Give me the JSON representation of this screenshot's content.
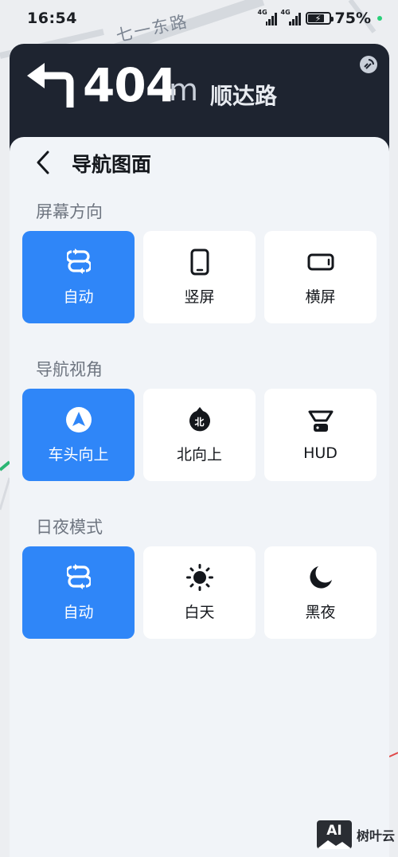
{
  "status_bar": {
    "time": "16:54",
    "signal_1_label": "4G",
    "signal_2_label": "4G",
    "battery_percent": "75%",
    "battery_level": 0.75
  },
  "map": {
    "road_name": "七一东路"
  },
  "navigation": {
    "distance_value": "404",
    "distance_unit": "m",
    "street_name": "顺达路",
    "turn_direction": "turn-left-icon"
  },
  "settings": {
    "title": "导航图面",
    "sections": [
      {
        "label": "屏幕方向",
        "options": [
          {
            "label": "自动",
            "icon": "auto-rotate-icon",
            "selected": true
          },
          {
            "label": "竖屏",
            "icon": "portrait-phone-icon",
            "selected": false
          },
          {
            "label": "横屏",
            "icon": "landscape-phone-icon",
            "selected": false
          }
        ]
      },
      {
        "label": "导航视角",
        "options": [
          {
            "label": "车头向上",
            "icon": "heading-up-icon",
            "selected": true
          },
          {
            "label": "北向上",
            "icon": "north-up-icon",
            "selected": false,
            "icon_text": "北"
          },
          {
            "label": "HUD",
            "icon": "hud-icon",
            "selected": false
          }
        ]
      },
      {
        "label": "日夜模式",
        "options": [
          {
            "label": "自动",
            "icon": "auto-mode-icon",
            "selected": true
          },
          {
            "label": "白天",
            "icon": "sun-icon",
            "selected": false
          },
          {
            "label": "黑夜",
            "icon": "moon-icon",
            "selected": false
          }
        ]
      }
    ]
  },
  "watermark": {
    "logo_text": "AI",
    "brand": "树叶云"
  },
  "colors": {
    "accent": "#2f86f8",
    "nav_header_bg": "#1e2430",
    "sheet_bg": "#f1f4f8"
  }
}
